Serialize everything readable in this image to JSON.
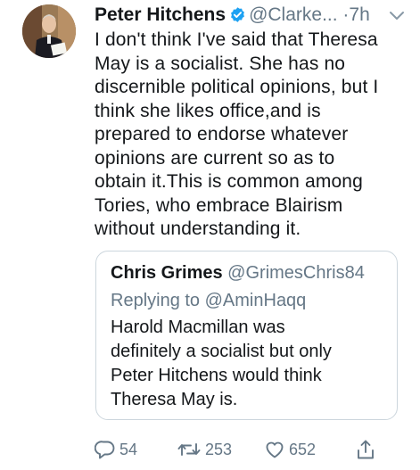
{
  "tweet": {
    "author_name": "Peter Hitchens",
    "author_handle": "@Clarke...",
    "separator": "·",
    "time": "7h",
    "text_lines": [
      "I don't think I've said that Theresa",
      "May is a socialist. She has no",
      "discernible political opinions, but I",
      "think she likes office,and is",
      "prepared to endorse whatever",
      "opinions are current so as to",
      "obtain it.This is common among",
      "Tories, who embrace Blairism",
      "without understanding it."
    ]
  },
  "quoted": {
    "author_name": "Chris Grimes",
    "author_handle": "@GrimesChris84",
    "replying_prefix": "Replying to ",
    "replying_to": "@AminHaqq",
    "text_lines": [
      "Harold Macmillan was",
      "definitely a socialist but only",
      "Peter Hitchens would think",
      "Theresa May is."
    ]
  },
  "actions": {
    "reply_count": "54",
    "retweet_count": "253",
    "like_count": "652"
  },
  "colors": {
    "text": "#14171a",
    "secondary": "#657786",
    "verified": "#1da1f2",
    "border": "#ccd6dd"
  },
  "icons": {
    "verified": "verified-badge-icon",
    "menu": "chevron-down-icon",
    "reply": "reply-icon",
    "retweet": "retweet-icon",
    "like": "heart-icon",
    "share": "share-icon"
  }
}
